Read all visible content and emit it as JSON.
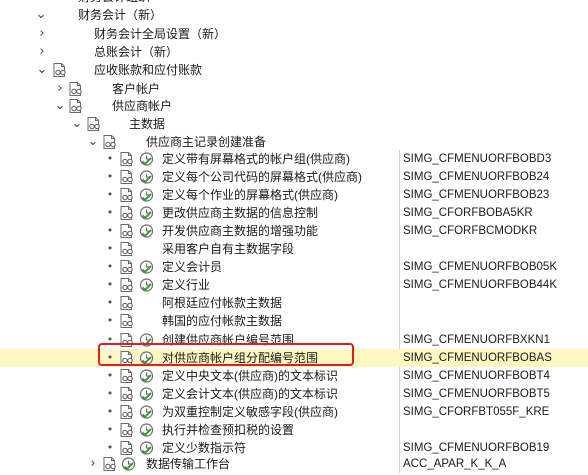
{
  "colors": {
    "highlight_bg": "#fff7c2",
    "annotation_border": "#e0201e",
    "icon_gray": "#666666",
    "clock_green": "#3a9a3a"
  },
  "icons": {
    "expand": "chevron-right-icon",
    "collapse": "chevron-down-icon",
    "document": "document-glasses-icon",
    "execute": "clock-check-icon"
  },
  "rows": [
    {
      "label": "财务会计（新）",
      "code": "",
      "state": "expanded"
    },
    {
      "label": "财务会计全局设置（新）",
      "code": "",
      "state": "collapsed"
    },
    {
      "label": "总账会计（新）",
      "code": "",
      "state": "collapsed"
    },
    {
      "label": "应收账款和应付账款",
      "code": "",
      "state": "expanded"
    },
    {
      "label": "客户帐户",
      "code": "",
      "state": "collapsed"
    },
    {
      "label": "供应商帐户",
      "code": "",
      "state": "expanded"
    },
    {
      "label": "主数据",
      "code": "",
      "state": "expanded"
    },
    {
      "label": "供应商主记录创建准备",
      "code": "",
      "state": "expanded"
    },
    {
      "label": "定义带有屏幕格式的帐户组(供应商)",
      "code": "SIMG_CFMENUORFBOBD3"
    },
    {
      "label": "定义每个公司代码的屏幕格式(供应商)",
      "code": "SIMG_CFMENUORFBOB24"
    },
    {
      "label": "定义每个作业的屏幕格式(供应商)",
      "code": "SIMG_CFMENUORFBOB23"
    },
    {
      "label": "更改供应商主数据的信息控制",
      "code": "SIMG_CFORFBOBA5KR"
    },
    {
      "label": "开发供应商主数据的增强功能",
      "code": "SIMG_CFORFBCMODKR"
    },
    {
      "label": "采用客户自有主数据字段",
      "code": ""
    },
    {
      "label": "定义会计员",
      "code": "SIMG_CFMENUORFBOB05K"
    },
    {
      "label": "定义行业",
      "code": "SIMG_CFMENUORFBOB44K"
    },
    {
      "label": "阿根廷应付帐款主数据",
      "code": ""
    },
    {
      "label": "韩国的应付帐款主数据",
      "code": ""
    },
    {
      "label": "创建供应商帐户编号范围",
      "code": "SIMG_CFMENUORFBXKN1"
    },
    {
      "label": "对供应商帐户组分配编号范围",
      "code": "SIMG_CFMENUORFBOBAS"
    },
    {
      "label": "定义中央文本(供应商)的文本标识",
      "code": "SIMG_CFMENUORFBOBT4"
    },
    {
      "label": "定义会计文本(供应商)的文本标识",
      "code": "SIMG_CFMENUORFBOBT5"
    },
    {
      "label": "为双重控制定义敏感字段(供应商)",
      "code": "SIMG_CFORFBT055F_KRE"
    },
    {
      "label": "执行并检查预扣税的设置",
      "code": ""
    },
    {
      "label": "定义少数指示符",
      "code": "SIMG_CFMENUORFBOB19"
    },
    {
      "label": "数据传输工作台",
      "code": "ACC_APAR_K_K_A",
      "state": "collapsed"
    }
  ]
}
